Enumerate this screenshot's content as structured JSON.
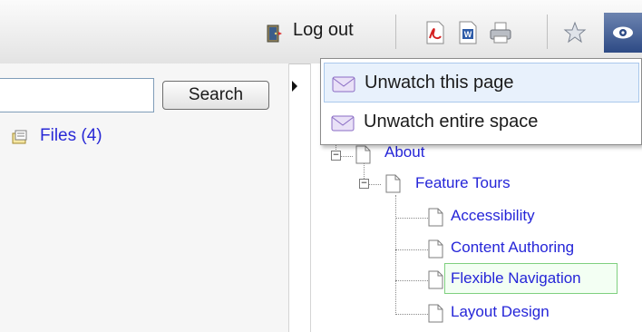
{
  "toolbar": {
    "logout_label": "Log out",
    "icons": [
      "logout-icon",
      "pdf-export-icon",
      "word-export-icon",
      "print-icon",
      "favourite-star-icon",
      "watch-eye-icon"
    ]
  },
  "search": {
    "input_value": "",
    "button_label": "Search",
    "files_link": "Files (4)"
  },
  "watch_menu": {
    "items": [
      {
        "label": "Unwatch this page",
        "icon": "envelope-icon"
      },
      {
        "label": "Unwatch entire space",
        "icon": "envelope-icon"
      }
    ]
  },
  "page_tree": {
    "items": [
      {
        "label": "About"
      },
      {
        "label": "Feature Tours"
      },
      {
        "label": "Accessibility"
      },
      {
        "label": "Content Authoring"
      },
      {
        "label": "Flexible Navigation",
        "selected": true
      },
      {
        "label": "Layout Design"
      }
    ]
  },
  "colors": {
    "link": "#2525d8",
    "selected_border": "#7fd07f",
    "menu_hover": "#e8f1fc",
    "eye_button": "#2d4a85"
  }
}
